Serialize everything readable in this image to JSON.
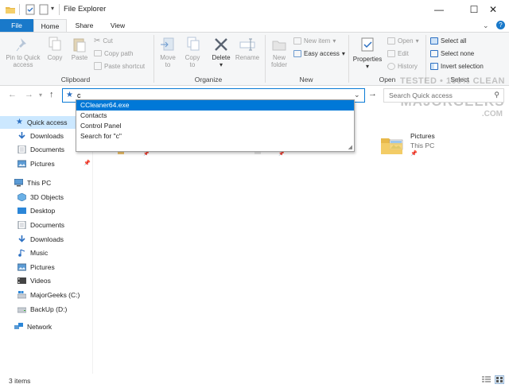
{
  "window": {
    "title": "File Explorer",
    "minimize_glyph": "—",
    "maximize_glyph": "☐",
    "close_glyph": "✕"
  },
  "tabs": [
    "File",
    "Home",
    "Share",
    "View"
  ],
  "ribbon": {
    "clipboard": {
      "pin_label_1": "Pin to Quick",
      "pin_label_2": "access",
      "copy": "Copy",
      "paste": "Paste",
      "cut": "Cut",
      "copy_path": "Copy path",
      "paste_shortcut": "Paste shortcut",
      "group": "Clipboard"
    },
    "organize": {
      "move_1": "Move",
      "move_2": "to",
      "copy_1": "Copy",
      "copy_2": "to",
      "delete": "Delete",
      "rename": "Rename",
      "group": "Organize"
    },
    "new": {
      "new_folder_1": "New",
      "new_folder_2": "folder",
      "new_item": "New item",
      "easy_access": "Easy access",
      "group": "New"
    },
    "open": {
      "properties": "Properties",
      "open": "Open",
      "edit": "Edit",
      "history": "History",
      "group": "Open"
    },
    "select": {
      "select_all": "Select all",
      "select_none": "Select none",
      "invert": "Invert selection",
      "group": "Select"
    }
  },
  "address": {
    "value": "c",
    "search_placeholder": "Search Quick access",
    "suggestions": [
      "CCleaner64.exe",
      "Contacts",
      "Control Panel",
      "Search for \"c\""
    ]
  },
  "sidebar": {
    "quick_access": "Quick access",
    "quick_items": [
      "Downloads",
      "Documents",
      "Pictures"
    ],
    "this_pc": "This PC",
    "pc_items": [
      "3D Objects",
      "Desktop",
      "Documents",
      "Downloads",
      "Music",
      "Pictures",
      "Videos",
      "MajorGeeks (C:)",
      "BackUp (D:)"
    ],
    "network": "Network"
  },
  "content": {
    "tile_name": "Pictures",
    "tile_location": "This PC"
  },
  "watermark": {
    "line1": "TESTED • 100% CLEAN",
    "line2": "MAJORGEEKS",
    "line3": ".COM"
  },
  "status": {
    "items": "3 items"
  }
}
